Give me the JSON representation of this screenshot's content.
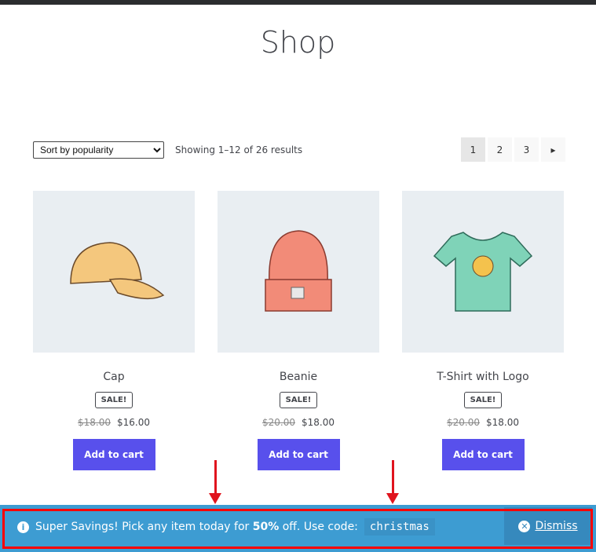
{
  "page": {
    "title": "Shop"
  },
  "toolbar": {
    "sort_selected": "Sort by popularity",
    "result_count": "Showing 1–12 of 26 results"
  },
  "pagination": {
    "pages": [
      "1",
      "2",
      "3"
    ],
    "current": "1",
    "next_icon": "triangle-right-icon"
  },
  "products": [
    {
      "name": "Cap",
      "badge": "SALE!",
      "old_price": "$18.00",
      "price": "$16.00",
      "button": "Add to cart"
    },
    {
      "name": "Beanie",
      "badge": "SALE!",
      "old_price": "$20.00",
      "price": "$18.00",
      "button": "Add to cart"
    },
    {
      "name": "T-Shirt with Logo",
      "badge": "SALE!",
      "old_price": "$20.00",
      "price": "$18.00",
      "button": "Add to cart"
    }
  ],
  "notice": {
    "text_before": "Super Savings! Pick any item today for",
    "bold": "50%",
    "text_after": "off. Use code:",
    "code": "christmas",
    "dismiss": "Dismiss",
    "background": "#3d9cd2"
  },
  "colors": {
    "button": "#5850ec",
    "annotation": "#ff0000"
  }
}
